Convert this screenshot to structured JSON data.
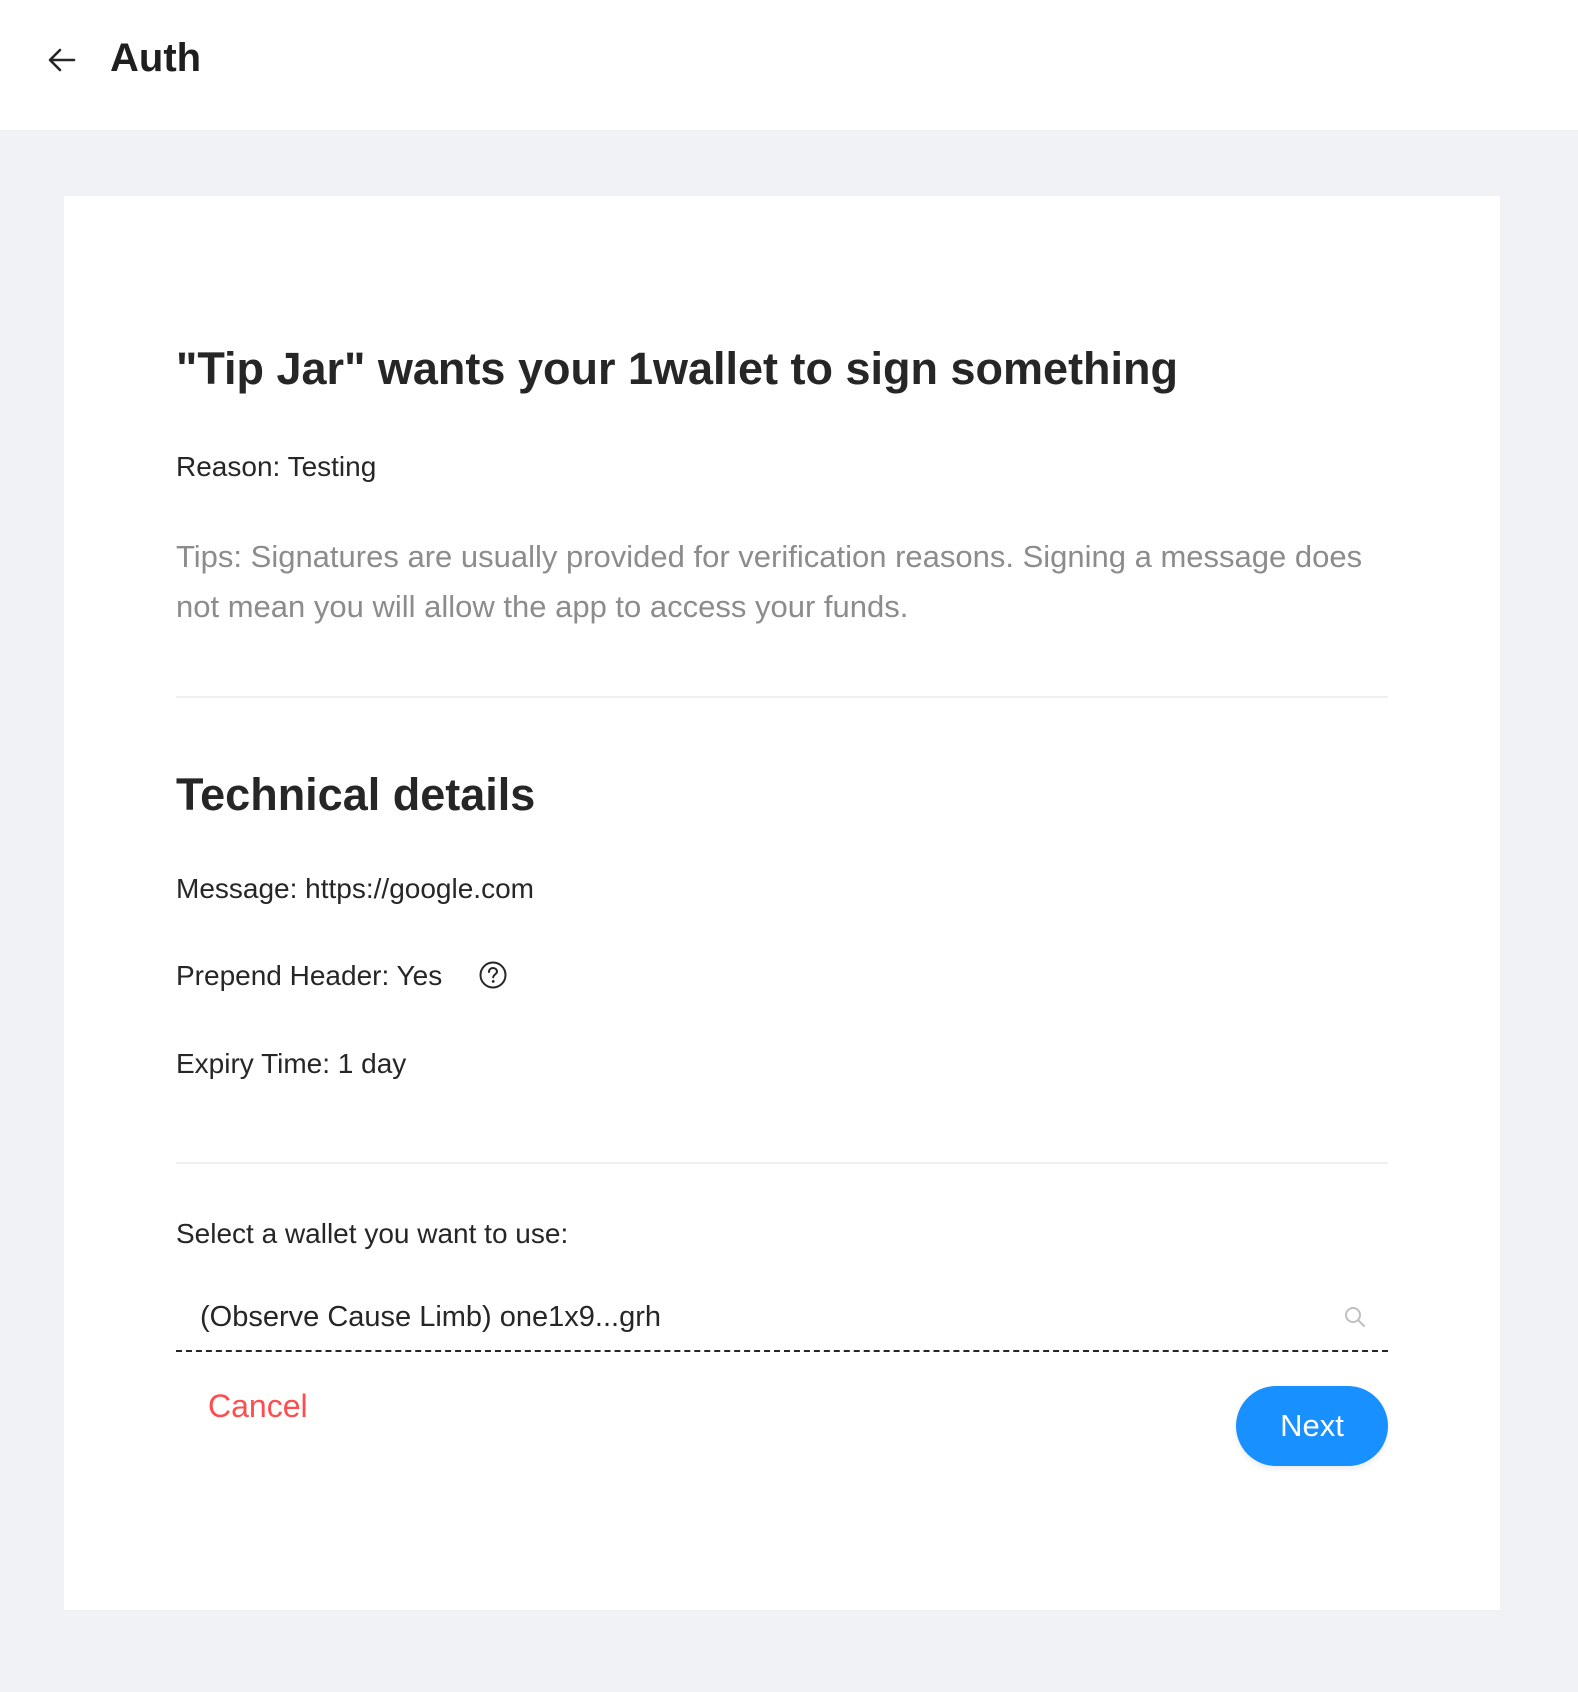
{
  "header": {
    "back_icon": "arrow-left-icon",
    "title": "Auth"
  },
  "request": {
    "title": "\"Tip Jar\" wants your 1wallet to sign something",
    "reason": "Reason: Testing",
    "tips": "Tips: Signatures are usually provided for verification reasons. Signing a message does not mean you will allow the app to access your funds."
  },
  "technical": {
    "title": "Technical details",
    "message": "Message: https://google.com",
    "prepend_header": "Prepend Header: Yes",
    "help_icon": "question-circle-icon",
    "expiry": "Expiry Time: 1 day"
  },
  "wallet": {
    "label": "Select a wallet you want to use:",
    "selected": "(Observe Cause Limb) one1x9...grh",
    "search_icon": "search-icon"
  },
  "actions": {
    "cancel_label": "Cancel",
    "next_label": "Next"
  },
  "colors": {
    "primary": "#1890ff",
    "danger": "#ff4d4f",
    "muted_text": "#8c8c8c",
    "page_bg": "#f0f2f5"
  }
}
